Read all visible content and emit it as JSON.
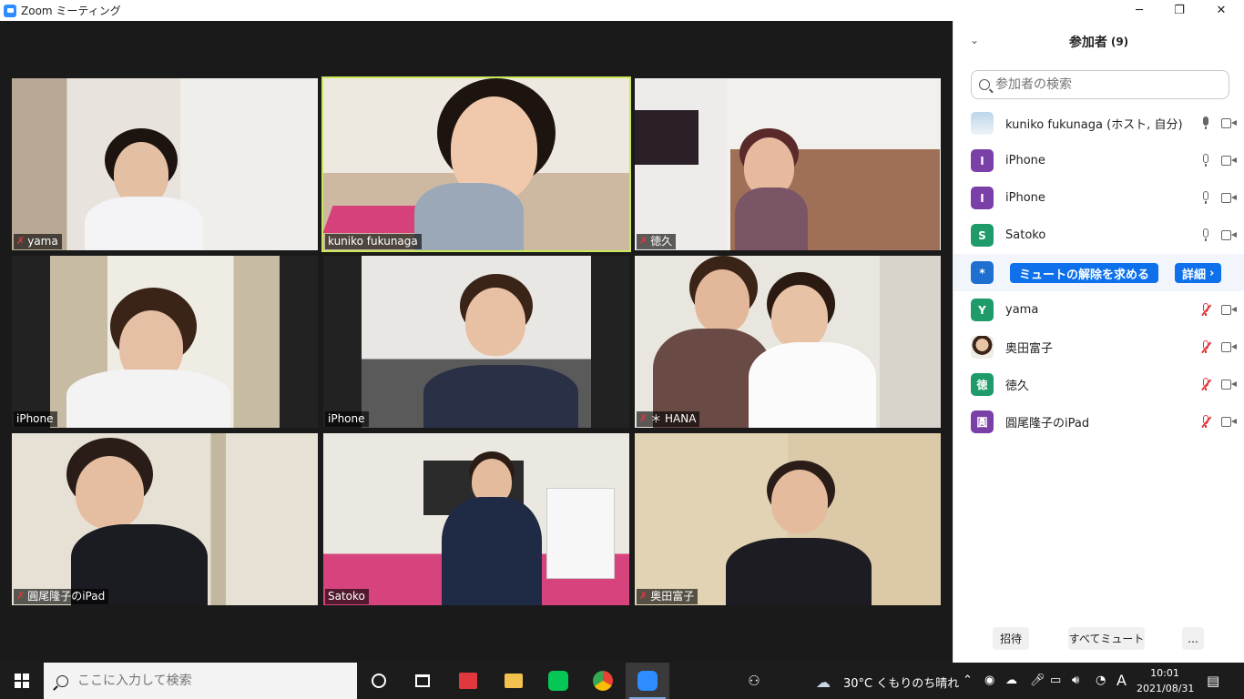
{
  "window": {
    "title": "Zoom ミーティング",
    "minimize_icon": "minimize-icon",
    "maximize_icon": "restore-icon",
    "close_icon": "close-icon"
  },
  "tiles": [
    {
      "name": "yama",
      "muted": true
    },
    {
      "name": "kuniko fukunaga",
      "muted": false,
      "speaking": true
    },
    {
      "name": "徳久",
      "muted": true
    },
    {
      "name": "iPhone",
      "muted": false
    },
    {
      "name": "iPhone",
      "muted": false
    },
    {
      "name": "＊ HANA",
      "muted": true
    },
    {
      "name": "圓尾隆子のiPad",
      "muted": true
    },
    {
      "name": "Satoko",
      "muted": false
    },
    {
      "name": "奥田富子",
      "muted": true
    }
  ],
  "panel": {
    "title": "参加者",
    "count": "(9)",
    "search_placeholder": "参加者の検索",
    "participants": [
      {
        "avatar": "",
        "avatar_color": "#8fb7d8",
        "name": "kuniko fukunaga (ホスト, 自分)",
        "mic": "on"
      },
      {
        "avatar": "I",
        "avatar_color": "#7b3fa8",
        "name": "iPhone",
        "mic": "on-outline"
      },
      {
        "avatar": "I",
        "avatar_color": "#7b3fa8",
        "name": "iPhone",
        "mic": "on-outline"
      },
      {
        "avatar": "S",
        "avatar_color": "#1f9b6a",
        "name": "Satoko",
        "mic": "on-outline"
      },
      {
        "avatar": "*",
        "avatar_color": "#1f6fd1",
        "name": "",
        "mic": "none"
      },
      {
        "avatar": "Y",
        "avatar_color": "#1f9b6a",
        "name": "yama",
        "mic": "off"
      },
      {
        "avatar": "",
        "avatar_color": "#d9b79a",
        "name": "奥田富子",
        "mic": "off"
      },
      {
        "avatar": "徳",
        "avatar_color": "#1f9b6a",
        "name": "徳久",
        "mic": "off"
      },
      {
        "avatar": "圓",
        "avatar_color": "#7b3fa8",
        "name": "圓尾隆子のiPad",
        "mic": "off"
      }
    ],
    "ask_unmute_label": "ミュートの解除を求める",
    "more_label": "詳細",
    "invite_label": "招待",
    "mute_all_label": "すべてミュート",
    "more_options_label": "..."
  },
  "taskbar": {
    "search_placeholder": "ここに入力して検索",
    "weather": "30°C くもりのち晴れ",
    "ime": "A",
    "time": "10:01",
    "date": "2021/08/31"
  },
  "colors": {
    "zoom_blue": "#0e71eb",
    "speaker_outline": "#c8e85a",
    "muted_red": "#e0383e"
  }
}
